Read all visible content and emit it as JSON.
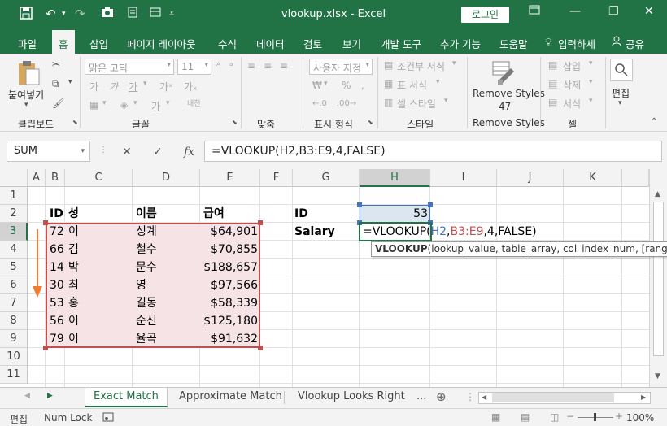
{
  "app": {
    "title": "vlookup.xlsx  -  Excel",
    "login_label": "로그인"
  },
  "menu": {
    "tabs": [
      "파일",
      "홈",
      "삽입",
      "페이지 레이아웃",
      "수식",
      "데이터",
      "검토",
      "보기",
      "개발 도구",
      "추가 기능",
      "도움말"
    ],
    "tell_me": "입력하세",
    "share": "공유"
  },
  "ribbon": {
    "clipboard": {
      "paste": "붙여넣기",
      "label": "클립보드"
    },
    "font": {
      "name": "맑은 고딕",
      "size": "11",
      "label": "글꼴"
    },
    "align": {
      "label": "맞춤"
    },
    "number": {
      "format": "사용자 지정",
      "label": "표시 형식"
    },
    "styles": {
      "cond": "조건부 서식",
      "table": "표 서식",
      "cell": "셀 스타일",
      "label": "스타일"
    },
    "remove": {
      "line1": "Remove Styles",
      "line2": "47",
      "label": "Remove Styles"
    },
    "cells": {
      "insert": "삽입",
      "delete": "삭제",
      "format": "서식",
      "label": "셀"
    },
    "edit": {
      "label": "편집"
    }
  },
  "formula_bar": {
    "name_box": "SUM",
    "formula": "=VLOOKUP(H2,B3:E9,4,FALSE)"
  },
  "columns": [
    "A",
    "B",
    "C",
    "D",
    "E",
    "F",
    "G",
    "H",
    "I",
    "J",
    "K"
  ],
  "rows": [
    "1",
    "2",
    "3",
    "4",
    "5",
    "6",
    "7",
    "8",
    "9",
    "10",
    "11"
  ],
  "table": {
    "headers": [
      "ID",
      "성",
      "이름",
      "급여"
    ],
    "rows": [
      [
        "72",
        "이",
        "성계",
        "$64,901"
      ],
      [
        "66",
        "김",
        "철수",
        "$70,855"
      ],
      [
        "14",
        "박",
        "문수",
        "$188,657"
      ],
      [
        "30",
        "최",
        "영",
        "$97,566"
      ],
      [
        "53",
        "홍",
        "길동",
        "$58,339"
      ],
      [
        "56",
        "이",
        "순신",
        "$125,180"
      ],
      [
        "79",
        "이",
        "율곡",
        "$91,632"
      ]
    ]
  },
  "lookup": {
    "id_label": "ID",
    "id_value": "53",
    "salary_label": "Salary",
    "formula_parts": {
      "prefix": "=VLOOKUP(",
      "arg1": "H2",
      "comma1": ",",
      "arg2": "B3:E9",
      "rest": ",4,FALSE)"
    },
    "tooltip_fn": "VLOOKUP",
    "tooltip_args": "(lookup_value, table_array, col_index_num, [range_looku"
  },
  "sheets": [
    "Exact Match",
    "Approximate Match",
    "Vlookup Looks Right"
  ],
  "sheets_more": "...",
  "status": {
    "mode": "편집",
    "num_lock": "Num Lock",
    "zoom": "100%"
  },
  "colors": {
    "accent": "#217346",
    "range_fill": "#f6e3e5",
    "range_border": "#c0504d",
    "ref_blue": "#4472c4",
    "ref_red": "#c0504d",
    "arrow": "#ed7d31"
  }
}
